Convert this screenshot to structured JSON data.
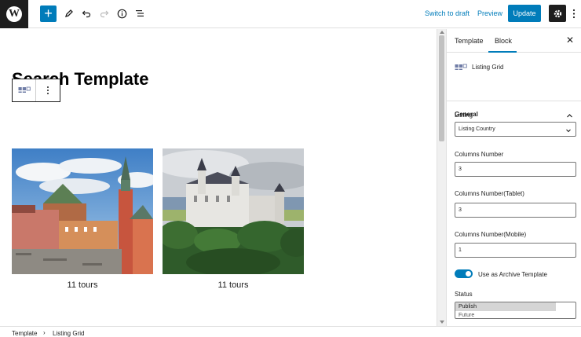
{
  "toolbar": {
    "logo_glyph": "W",
    "add_glyph": "+",
    "switch_to_draft": "Switch to draft",
    "preview": "Preview",
    "update": "Update",
    "icons": [
      "wordpress-logo-icon",
      "plus-icon",
      "pencil-icon",
      "undo-icon",
      "redo-icon",
      "info-icon",
      "list-view-icon",
      "gear-icon",
      "more-vertical-icon"
    ]
  },
  "canvas": {
    "page_title": "Search Template",
    "cards": [
      {
        "caption": "11 tours",
        "image": "warsaw-castle-square-photo"
      },
      {
        "caption": "11 tours",
        "image": "neuschwanstein-castle-photo"
      }
    ]
  },
  "sidebar": {
    "tabs": [
      {
        "label": "Template",
        "active": false
      },
      {
        "label": "Block",
        "active": true
      }
    ],
    "close_glyph": "✕",
    "block_name": "Listing Grid",
    "panel_title": "General",
    "fields": {
      "listing_label": "Listing",
      "listing_value": "Listing Country",
      "columns_label": "Columns Number",
      "columns_value": "3",
      "columns_tablet_label": "Columns Number(Tablet)",
      "columns_tablet_value": "3",
      "columns_mobile_label": "Columns Number(Mobile)",
      "columns_mobile_value": "1",
      "archive_toggle_label": "Use as Archive Template",
      "archive_toggle_on": true,
      "status_label": "Status",
      "status_options": [
        "Publish",
        "Future"
      ]
    }
  },
  "footer": {
    "crumbs": [
      "Template",
      "Listing Grid"
    ],
    "separator": "›"
  },
  "colors": {
    "accent": "#007cba",
    "dark": "#1e1e1e"
  }
}
